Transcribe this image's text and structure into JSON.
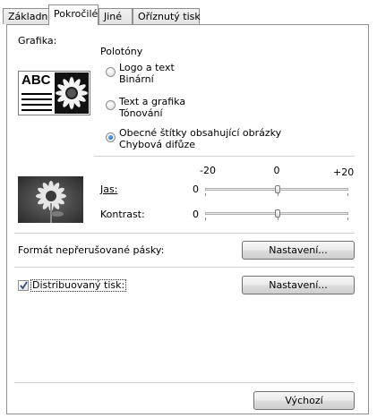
{
  "tabs": [
    {
      "label": "Základní",
      "active": false
    },
    {
      "label": "Pokročilé",
      "active": true
    },
    {
      "label": "Jiné",
      "active": false
    },
    {
      "label": "Oříznutý tisk",
      "active": false
    }
  ],
  "graphics": {
    "label": "Grafika:",
    "halftone_label": "Polotóny",
    "preview_text": "ABC",
    "options": [
      {
        "line1": "Logo a text",
        "line2": "Binární",
        "selected": false
      },
      {
        "line1": "Text a grafika",
        "line2": "Tónování",
        "selected": false
      },
      {
        "line1": "Obecné štítky obsahující obrázky",
        "line2": "Chybová difůze",
        "selected": true
      }
    ]
  },
  "adjust": {
    "scale_min": "-20",
    "scale_mid": "0",
    "scale_max": "+20",
    "brightness_label": "Jas:",
    "brightness_value": "0",
    "contrast_label": "Kontrast:",
    "contrast_value": "0"
  },
  "tape_format": {
    "label": "Formát nepřerušované pásky:",
    "button": "Nastavení..."
  },
  "distributed_print": {
    "label": "Distribuovaný tisk:",
    "checked": true,
    "button": "Nastavení..."
  },
  "default_button": "Výchozí"
}
